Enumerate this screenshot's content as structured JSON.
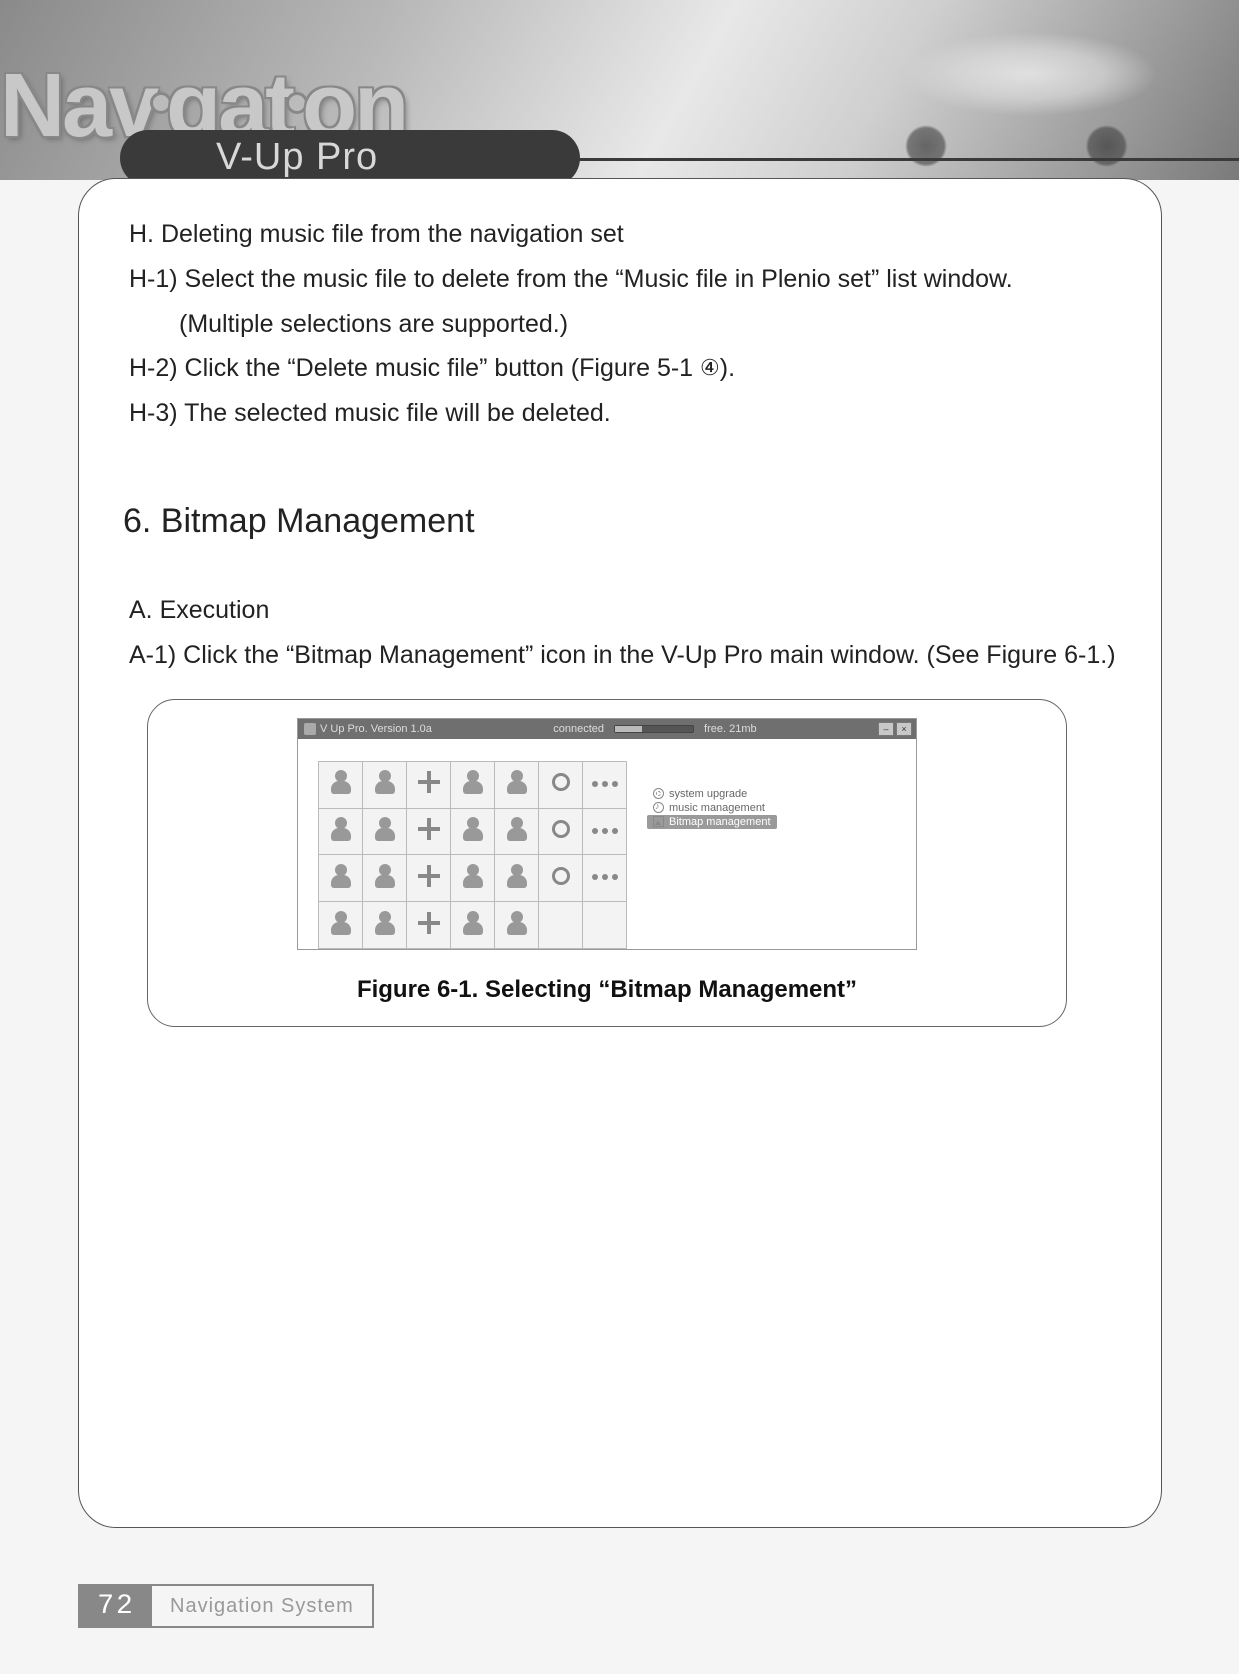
{
  "header": {
    "brand": "Navigation",
    "pill": "V-Up Pro"
  },
  "content": {
    "h_title": "H. Deleting music file from the navigation set",
    "h1": "H-1) Select the music file to delete from the “Music file in Plenio set” list window.",
    "h1_note": "(Multiple selections are supported.)",
    "h2_pre": "H-2) Click the “Delete music file” button (Figure 5-1 ",
    "h2_num": "④",
    "h2_post": ").",
    "h3": "H-3) The selected music file will be deleted.",
    "section_heading": "6. Bitmap Management",
    "a_title": "A. Execution",
    "a1": "A-1) Click the “Bitmap Management” icon in the V-Up Pro main window. (See Figure 6-1.)"
  },
  "app": {
    "title": "V Up Pro. Version 1.0a",
    "status": "connected",
    "free": "free. 21mb",
    "menu": {
      "upgrade": "system upgrade",
      "music": "music management",
      "bitmap": "Bitmap management"
    }
  },
  "figure_caption": "Figure 6-1. Selecting “Bitmap Management”",
  "footer": {
    "page": "72",
    "label": "Navigation System"
  }
}
